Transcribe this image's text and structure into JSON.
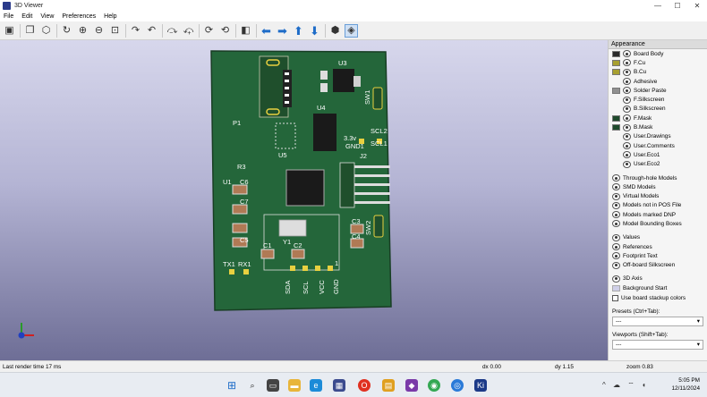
{
  "window": {
    "title": "3D Viewer",
    "controls": [
      "—",
      "☐",
      "✕"
    ]
  },
  "menu": [
    "File",
    "Edit",
    "View",
    "Preferences",
    "Help"
  ],
  "pcb": {
    "silkscreen": [
      "P1",
      "U3",
      "U4",
      "SW1",
      "SCL2",
      "3.3v",
      "GND1",
      "SCL1",
      "U5",
      "R3",
      "U1",
      "C6",
      "C7",
      "C5",
      "J2",
      "C3",
      "C4",
      "SW2",
      "C1",
      "Y1",
      "C2",
      "TX1",
      "RX1",
      "SDA",
      "SCL",
      "VCC",
      "GND",
      "1"
    ]
  },
  "appearance": {
    "heading": "Appearance",
    "layers": [
      {
        "label": "Board Body",
        "color": "#2a2a2a"
      },
      {
        "label": "F.Cu",
        "color": "#a8a030"
      },
      {
        "label": "B.Cu",
        "color": "#a8a030"
      },
      {
        "label": "Adhesive",
        "color": ""
      },
      {
        "label": "Solder Paste",
        "color": "#909090"
      },
      {
        "label": "F.Silkscreen",
        "color": ""
      },
      {
        "label": "B.Silkscreen",
        "color": ""
      },
      {
        "label": "F.Mask",
        "color": "#1f4a2c"
      },
      {
        "label": "B.Mask",
        "color": "#1f4a2c"
      },
      {
        "label": "User.Drawings",
        "color": ""
      },
      {
        "label": "User.Comments",
        "color": ""
      },
      {
        "label": "User.Eco1",
        "color": ""
      },
      {
        "label": "User.Eco2",
        "color": ""
      }
    ],
    "models": [
      "Through-hole Models",
      "SMD Models",
      "Virtual Models",
      "Models not in POS File",
      "Models marked DNP",
      "Model Bounding Boxes"
    ],
    "texts": [
      "Values",
      "References",
      "Footprint Text",
      "Off-board Silkscreen"
    ],
    "misc": [
      {
        "label": "3D Axis"
      },
      {
        "label": "Background Start"
      }
    ],
    "stackup_label": "Use board stackup colors",
    "presets_label": "Presets (Ctrl+Tab):",
    "presets_value": "---",
    "viewports_label": "Viewports (Shift+Tab):",
    "viewports_value": "---"
  },
  "status": {
    "render": "Last render time 17 ms",
    "dx": "dx 0.00",
    "dy": "dy 1.15",
    "zoom": "zoom 0.83"
  },
  "clock": {
    "time": "5:05 PM",
    "date": "12/11/2024"
  }
}
